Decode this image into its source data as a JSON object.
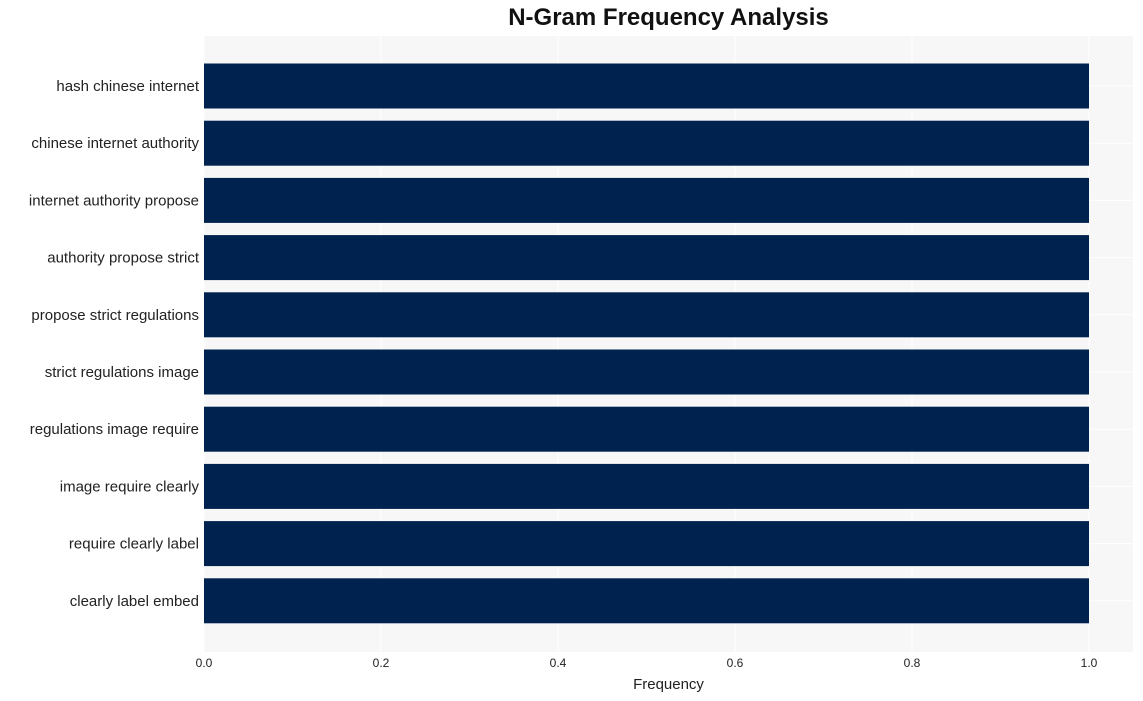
{
  "chart_data": {
    "type": "bar",
    "orientation": "horizontal",
    "title": "N-Gram Frequency Analysis",
    "xlabel": "Frequency",
    "ylabel": "",
    "categories": [
      "hash chinese internet",
      "chinese internet authority",
      "internet authority propose",
      "authority propose strict",
      "propose strict regulations",
      "strict regulations image",
      "regulations image require",
      "image require clearly",
      "require clearly label",
      "clearly label embed"
    ],
    "values": [
      1,
      1,
      1,
      1,
      1,
      1,
      1,
      1,
      1,
      1
    ],
    "xlim": [
      0,
      1.05
    ],
    "xticks": [
      0.0,
      0.2,
      0.4,
      0.6,
      0.8,
      1.0
    ],
    "xtick_labels": [
      "0.0",
      "0.2",
      "0.4",
      "0.6",
      "0.8",
      "1.0"
    ],
    "grid": true,
    "legend": "none",
    "colors": {
      "bar": "#00224e",
      "plot_bg": "#f7f7f7",
      "grid": "#ffffff"
    }
  }
}
